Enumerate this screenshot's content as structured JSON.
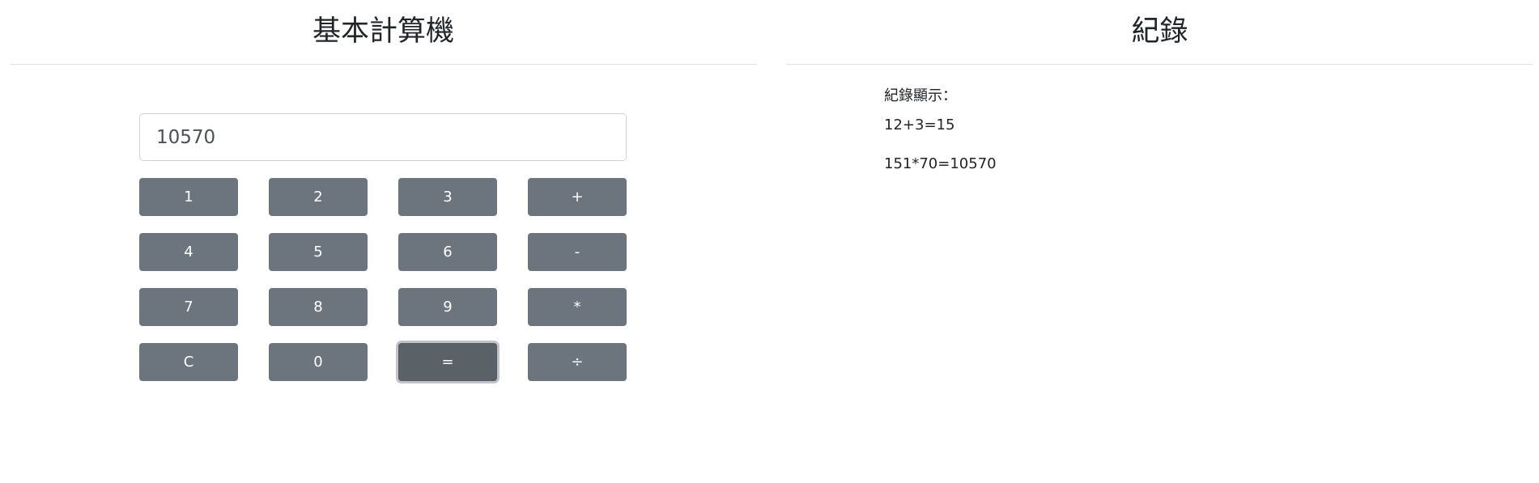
{
  "calculator": {
    "title": "基本計算機",
    "display_value": "10570",
    "keys": [
      {
        "id": "1",
        "label": "1"
      },
      {
        "id": "2",
        "label": "2"
      },
      {
        "id": "3",
        "label": "3"
      },
      {
        "id": "plus",
        "label": "+"
      },
      {
        "id": "4",
        "label": "4"
      },
      {
        "id": "5",
        "label": "5"
      },
      {
        "id": "6",
        "label": "6"
      },
      {
        "id": "minus",
        "label": "-"
      },
      {
        "id": "7",
        "label": "7"
      },
      {
        "id": "8",
        "label": "8"
      },
      {
        "id": "9",
        "label": "9"
      },
      {
        "id": "multiply",
        "label": "*"
      },
      {
        "id": "clear",
        "label": "C"
      },
      {
        "id": "0",
        "label": "0"
      },
      {
        "id": "equals",
        "label": "="
      },
      {
        "id": "divide",
        "label": "÷"
      }
    ]
  },
  "records": {
    "title": "紀錄",
    "label": "紀錄顯示：",
    "entries": [
      "12+3=15",
      "151*70=10570"
    ]
  },
  "colors": {
    "button": "#6c757d",
    "button_focused": "#5a6268",
    "divider": "#dee2e6"
  }
}
